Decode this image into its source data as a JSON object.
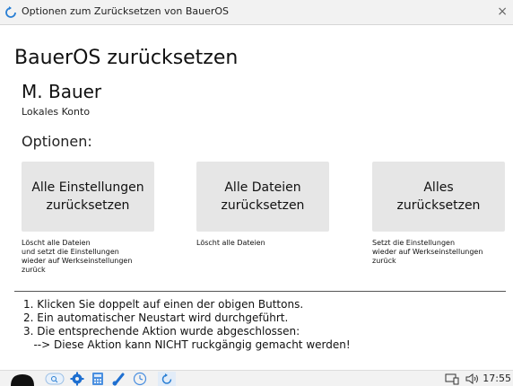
{
  "window": {
    "title": "Optionen zum Zurücksetzen von BauerOS",
    "close_glyph": "×",
    "icon": "refresh-icon"
  },
  "main": {
    "heading": "BauerOS zurücksetzen",
    "user_name": "M. Bauer",
    "account_type": "Lokales Konto",
    "options_label": "Optionen:"
  },
  "options": [
    {
      "label": "Alle Einstellungen\nzurücksetzen",
      "description": "Löscht alle Dateien\nund setzt die Einstellungen\nwieder auf Werkseinstellungen\nzurück"
    },
    {
      "label": "Alle Dateien\nzurücksetzen",
      "description": "Löscht alle Dateien"
    },
    {
      "label": "Alles\nzurücksetzen",
      "description": "Setzt die Einstellungen\nwieder auf Werkseinstellungen\nzurück"
    }
  ],
  "instructions": [
    "1. Klicken Sie doppelt auf einen der obigen Buttons.",
    "2. Ein automatischer Neustart wird durchgeführt.",
    "3. Die entsprechende Aktion wurde abgeschlossen:",
    "   --> Diese Aktion kann NICHT ruckgängig gemacht werden!"
  ],
  "taskbar": {
    "apps": [
      "start-icon",
      "search-icon",
      "settings-icon",
      "calculator-icon",
      "paint-icon",
      "clock-app-icon",
      "reset-app-icon"
    ],
    "tray": [
      "network-icon",
      "volume-icon"
    ],
    "clock": "17:55",
    "accent": "#2a7fd4"
  }
}
